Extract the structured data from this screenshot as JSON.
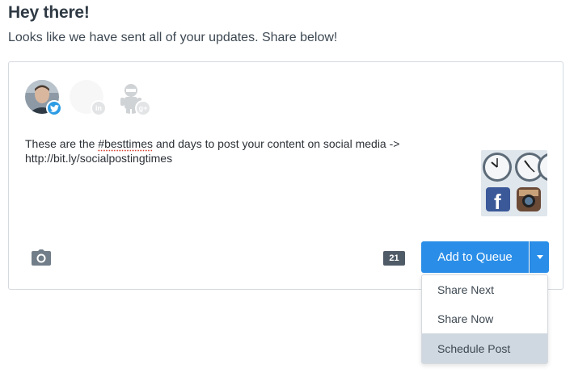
{
  "header": {
    "title": "Hey there!",
    "subtitle": "Looks like we have sent all of your updates. Share below!"
  },
  "composer": {
    "profiles": [
      {
        "network": "twitter",
        "selected": true,
        "badge": "twitter-bird-icon"
      },
      {
        "network": "linkedin",
        "selected": false,
        "badge": "in"
      },
      {
        "network": "google-plus",
        "selected": false,
        "badge": "g+"
      }
    ],
    "text_before_hashtag": "These are the ",
    "hashtag": "#besttimes",
    "text_after_hashtag": " and days to post your content on social media ->",
    "link": "http://bit.ly/socialpostingtimes",
    "character_count": "21",
    "attach_icon": "camera-icon",
    "add_button_label": "Add to Queue",
    "dropdown_items": [
      "Share Next",
      "Share Now",
      "Schedule Post"
    ],
    "highlighted_item": "Schedule Post"
  },
  "colors": {
    "accent": "#2a8ee8",
    "twitter": "#2c9ce4",
    "count_badge": "#4f5b66",
    "highlight": "#cfd8e0"
  }
}
